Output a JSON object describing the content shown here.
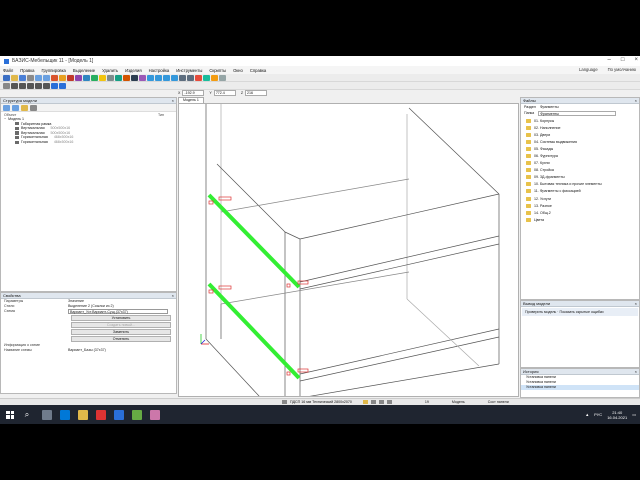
{
  "window": {
    "title": "БАЗИС-Мебельщик 11 - [Модель 1]"
  },
  "menu": {
    "items": [
      "Файл",
      "Правка",
      "Группировка",
      "Выделение",
      "Удалить",
      "Изделия",
      "Настройка",
      "Инструменты",
      "Скрипты",
      "Окно",
      "Справка"
    ],
    "language": "Language",
    "default_label": "По умолчанию"
  },
  "coords": {
    "x_label": "X",
    "x_value": "-192.9",
    "y_label": "Y",
    "y_value": "772.4",
    "z_label": "Z",
    "z_value": "216"
  },
  "model_tree": {
    "title": "Структура модели",
    "col_objects": "Объект",
    "col_type": "Тип",
    "root": "Модель 1",
    "items": [
      {
        "name": "Габаритная рамка",
        "dim": ""
      },
      {
        "name": "Вертикальная",
        "dim": "500х500х16"
      },
      {
        "name": "Вертикальная",
        "dim": "500х500х16"
      },
      {
        "name": "Горизонтальная",
        "dim": "468х500х16"
      },
      {
        "name": "Горизонтальная",
        "dim": "468х500х16"
      }
    ]
  },
  "properties": {
    "title": "Свойства",
    "rows": [
      {
        "k": "Параметры",
        "v": "Значение"
      },
      {
        "k": "Стили",
        "v": "Выделение 2 (Ссылки из 2)"
      },
      {
        "k": "Схема",
        "v": "Вариант_Уст.Вариант-Сущ.(37х37)"
      }
    ],
    "buttons": [
      "Установить",
      "Создать новый...",
      "Заменить",
      "Отменить"
    ],
    "section": "Информация о схеме",
    "last_k": "Название схемы",
    "last_v": "Вариант_Базы (37х37)"
  },
  "viewport_tab": "Модель 1",
  "files": {
    "title": "Файлы",
    "filter_label": "Раздел",
    "filter_value": "Фрагменты",
    "filter2_label": "Папка",
    "filter2_value": "Фрагменты",
    "folders": [
      "01. Корпусы",
      "02. Наполнение",
      "03. Двери",
      "04. Системы выдвижения",
      "05. Фасады",
      "06. Фурнитура",
      "07. Кухни",
      "08. Стройка",
      "09. 3Д-фрагменты",
      "10. Бытовая техника и прочие элементы",
      "11. Фрагменты с фиксацией",
      "12. Услуги",
      "13. Разное",
      "14. Общ.2",
      "Цвета"
    ]
  },
  "view_panel": {
    "title": "Вывод модели",
    "row": "Проверить модель · Показать скрытые ощибки"
  },
  "history": {
    "title": "История",
    "items": [
      "Установка панели",
      "Установка панели",
      "Установка панели"
    ]
  },
  "status": {
    "text": "ПДСП 16 мм Технический  2800х2070",
    "zoom": "19",
    "view": "Модель",
    "mode": "Сост панели"
  },
  "taskbar": {
    "lang": "РУС",
    "time": "21:40",
    "date": "16.04.2021"
  },
  "colors": {
    "highlight": "#33ee33",
    "edge": "#555555",
    "accent": "#2a6fd8"
  }
}
